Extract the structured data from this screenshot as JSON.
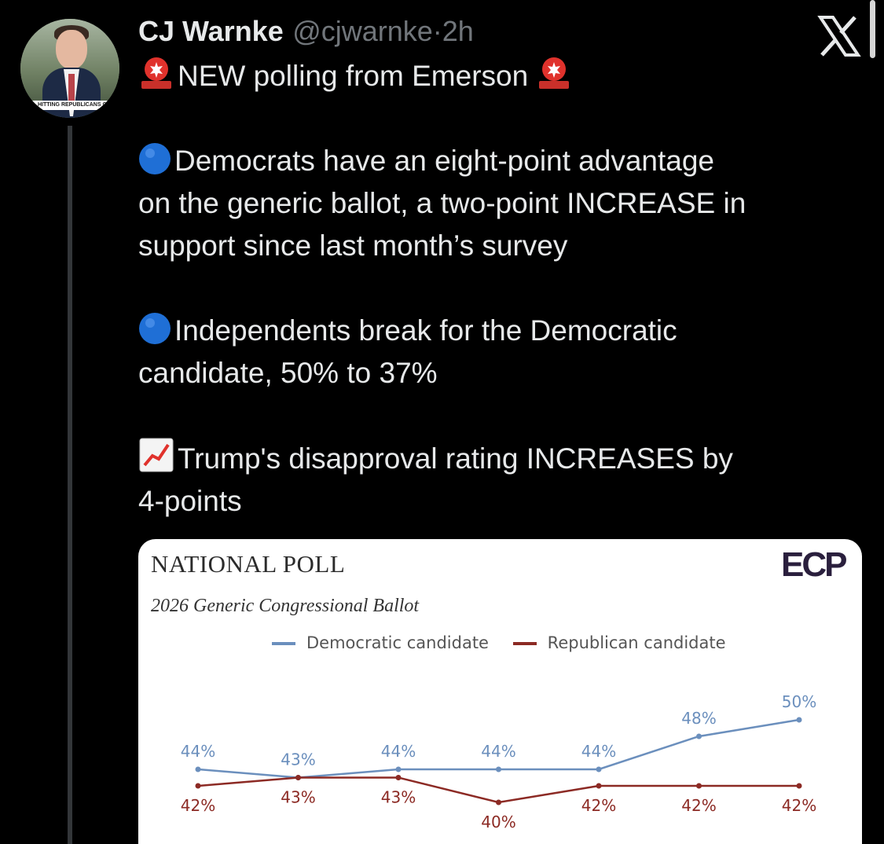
{
  "author": {
    "name": "CJ Warnke",
    "handle": "@cjwarnke",
    "separator": "·",
    "time": "2h"
  },
  "avatar": {
    "banner_text": "HITTING REPUBLICANS ON ME"
  },
  "icons": {
    "platform": "x-logo-icon",
    "siren": "siren-emoji",
    "blue_circle": "blue-circle-emoji",
    "chart": "chart-increasing-emoji"
  },
  "tweet": {
    "line1": "NEW polling from Emerson",
    "p2_l1": "Democrats have an eight-point advantage",
    "p2_l2": "on the generic ballot, a two-point INCREASE in",
    "p2_l3": "support since last month’s survey",
    "p3_l1": "Independents break for the Democratic",
    "p3_l2": "candidate, 50% to 37%",
    "p4_l1": "Trump's disapproval rating INCREASES by",
    "p4_l2": "4-points"
  },
  "card": {
    "title": "NATIONAL POLL",
    "subtitle": "2026 Generic Congressional Ballot",
    "logo": "ECP"
  },
  "colors": {
    "dem": "#6b8fbd",
    "rep": "#8c2a24",
    "background": "#000000",
    "card": "#ffffff"
  },
  "chart_data": {
    "type": "line",
    "title": "NATIONAL POLL",
    "subtitle": "2026 Generic Congressional Ballot",
    "legend_position": "top",
    "series": [
      {
        "name": "Democratic candidate",
        "values": [
          44,
          43,
          44,
          44,
          44,
          48,
          50
        ],
        "labels": [
          "44%",
          "43%",
          "44%",
          "44%",
          "44%",
          "48%",
          "50%"
        ]
      },
      {
        "name": "Republican candidate",
        "values": [
          42,
          43,
          43,
          40,
          42,
          42,
          42
        ],
        "labels": [
          "42%",
          "43%",
          "43%",
          "40%",
          "42%",
          "42%",
          "42%"
        ]
      }
    ]
  }
}
